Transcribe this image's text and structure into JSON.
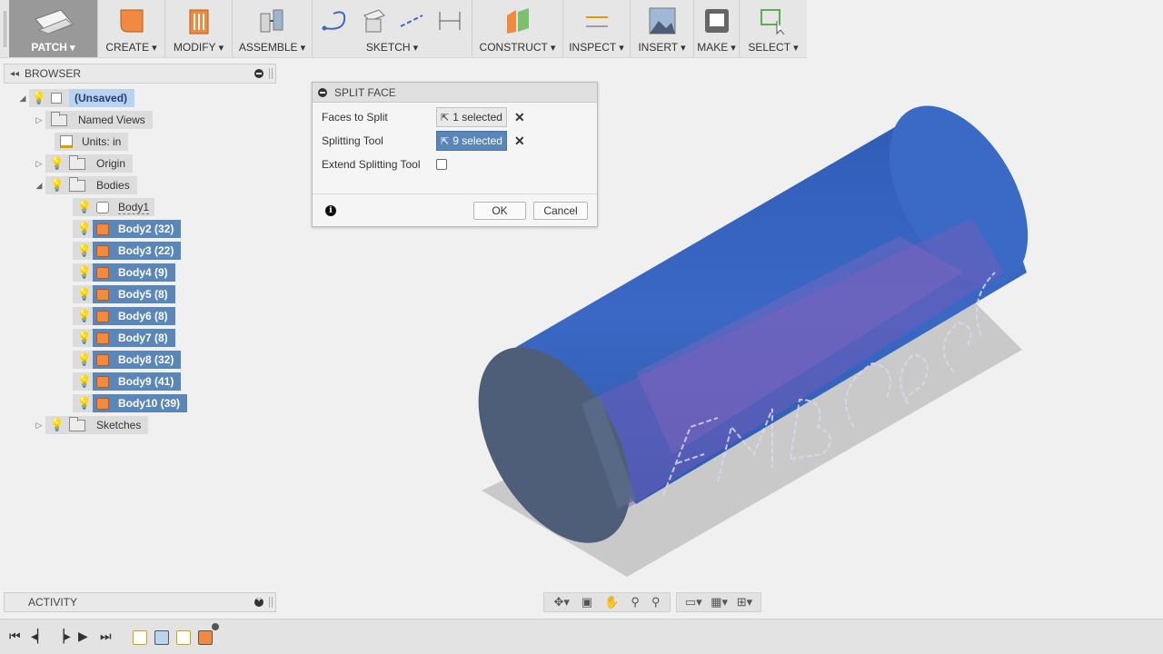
{
  "toolbar": {
    "groups": [
      {
        "label": "PATCH",
        "icon": "patch-surface-icon"
      },
      {
        "label": "CREATE",
        "icon": "create-box-icon"
      },
      {
        "label": "MODIFY",
        "icon": "modify-press-pull-icon"
      },
      {
        "label": "ASSEMBLE",
        "icon": "joint-icon"
      },
      {
        "label": "SKETCH",
        "icon": "sketch-tools-icon"
      },
      {
        "label": "CONSTRUCT",
        "icon": "construct-plane-icon"
      },
      {
        "label": "INSPECT",
        "icon": "measure-icon"
      },
      {
        "label": "INSERT",
        "icon": "insert-image-icon"
      },
      {
        "label": "MAKE",
        "icon": "3d-print-icon"
      },
      {
        "label": "SELECT",
        "icon": "select-window-icon"
      }
    ]
  },
  "browser": {
    "title": "BROWSER",
    "root": "(Unsaved)",
    "named_views": "Named Views",
    "units": "Units: in",
    "origin": "Origin",
    "bodies": "Bodies",
    "body_items": [
      "Body1",
      "Body2 (32)",
      "Body3 (22)",
      "Body4 (9)",
      "Body5 (8)",
      "Body6 (8)",
      "Body7 (8)",
      "Body8 (32)",
      "Body9 (41)",
      "Body10 (39)"
    ],
    "sketches": "Sketches"
  },
  "dialog": {
    "title": "SPLIT FACE",
    "faces_label": "Faces to Split",
    "faces_value": "1 selected",
    "tool_label": "Splitting Tool",
    "tool_value": "9 selected",
    "extend_label": "Extend Splitting Tool",
    "extend_checked": false,
    "ok": "OK",
    "cancel": "Cancel"
  },
  "activity": {
    "title": "ACTIVITY"
  },
  "colors": {
    "cylinder": "#3a68c4",
    "cylinder_end": "#4d5f7a",
    "selection": "#5b86b8",
    "text_inside": "#8e4fa8"
  }
}
